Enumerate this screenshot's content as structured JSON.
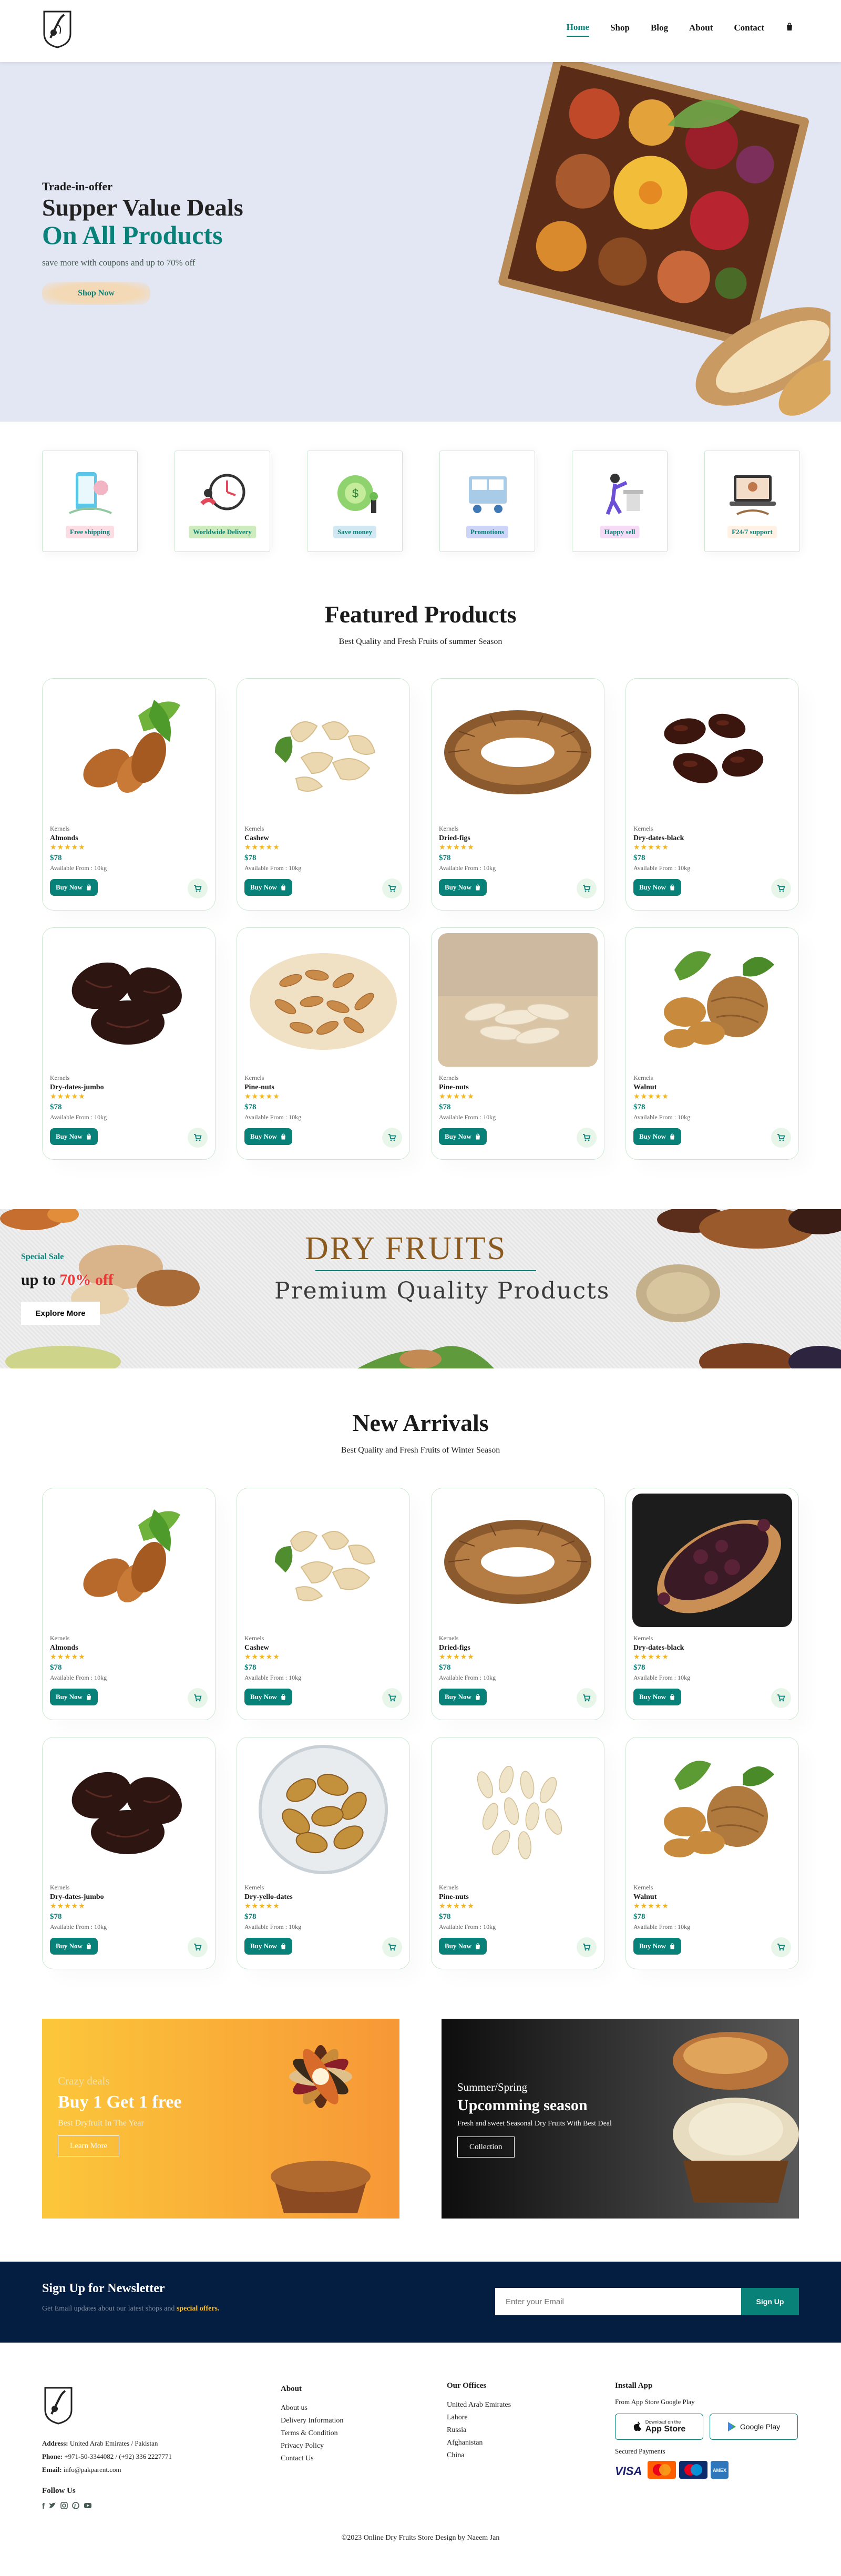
{
  "header": {
    "nav": [
      "Home",
      "Shop",
      "Blog",
      "About",
      "Contact"
    ],
    "cart_icon": "shopping-bag-icon"
  },
  "hero": {
    "subtitle": "Trade-in-offer",
    "title": "Supper Value Deals",
    "highlight": "On All Products",
    "text": "save more with coupons and up to 70% off",
    "button": "Shop Now"
  },
  "features": [
    {
      "label": "Free shipping",
      "color": "#fddde4"
    },
    {
      "label": "Worldwide Delivery",
      "color": "#cdebbc"
    },
    {
      "label": "Save money",
      "color": "#d1e8f2"
    },
    {
      "label": "Promotions",
      "color": "#cdd4f8"
    },
    {
      "label": "Happy sell",
      "color": "#f6dbf6"
    },
    {
      "label": "F24/7 support",
      "color": "#fff2e5"
    }
  ],
  "featured": {
    "title": "Featured Products",
    "subtitle": "Best Quality and Fresh Fruits of summer Season",
    "products": [
      {
        "brand": "Kernels",
        "name": "Almonds",
        "rating": "★★★★★",
        "price": "$78",
        "avail": "Available From : 10kg",
        "buy": "Buy Now"
      },
      {
        "brand": "Kernels",
        "name": "Cashew",
        "rating": "★★★★★",
        "price": "$78",
        "avail": "Available From : 10kg",
        "buy": "Buy Now"
      },
      {
        "brand": "Kernels",
        "name": "Dried-figs",
        "rating": "★★★★★",
        "price": "$78",
        "avail": "Available From : 10kg",
        "buy": "Buy Now"
      },
      {
        "brand": "Kernels",
        "name": "Dry-dates-black",
        "rating": "★★★★★",
        "price": "$78",
        "avail": "Available From : 10kg",
        "buy": "Buy Now"
      },
      {
        "brand": "Kernels",
        "name": "Dry-dates-jumbo",
        "rating": "★★★★★",
        "price": "$78",
        "avail": "Available From : 10kg",
        "buy": "Buy Now"
      },
      {
        "brand": "Kernels",
        "name": "Pine-nuts",
        "rating": "★★★★★",
        "price": "$78",
        "avail": "Available From : 10kg",
        "buy": "Buy Now"
      },
      {
        "brand": "Kernels",
        "name": "Pine-nuts",
        "rating": "★★★★★",
        "price": "$78",
        "avail": "Available From : 10kg",
        "buy": "Buy Now"
      },
      {
        "brand": "Kernels",
        "name": "Walnut",
        "rating": "★★★★★",
        "price": "$78",
        "avail": "Available From : 10kg",
        "buy": "Buy Now"
      }
    ]
  },
  "banner": {
    "special": "Special Sale",
    "upto": "up to ",
    "percent": "70% off",
    "button": "Explore More",
    "headline": "DRY FRUITS",
    "tagline": "Premium Quality Products"
  },
  "arrivals": {
    "title": "New Arrivals",
    "subtitle": "Best Quality and Fresh Fruits of Winter Season",
    "products": [
      {
        "brand": "Kernels",
        "name": "Almonds",
        "rating": "★★★★★",
        "price": "$78",
        "avail": "Available From : 10kg",
        "buy": "Buy Now"
      },
      {
        "brand": "Kernels",
        "name": "Cashew",
        "rating": "★★★★★",
        "price": "$78",
        "avail": "Available From : 10kg",
        "buy": "Buy Now"
      },
      {
        "brand": "Kernels",
        "name": "Dried-figs",
        "rating": "★★★★★",
        "price": "$78",
        "avail": "Available From : 10kg",
        "buy": "Buy Now"
      },
      {
        "brand": "Kernels",
        "name": "Dry-dates-black",
        "rating": "★★★★★",
        "price": "$78",
        "avail": "Available From : 10kg",
        "buy": "Buy Now"
      },
      {
        "brand": "Kernels",
        "name": "Dry-dates-jumbo",
        "rating": "★★★★★",
        "price": "$78",
        "avail": "Available From : 10kg",
        "buy": "Buy Now"
      },
      {
        "brand": "Kernels",
        "name": "Dry-yello-dates",
        "rating": "★★★★★",
        "price": "$78",
        "avail": "Available From : 10kg",
        "buy": "Buy Now"
      },
      {
        "brand": "Kernels",
        "name": "Pine-nuts",
        "rating": "★★★★★",
        "price": "$78",
        "avail": "Available From : 10kg",
        "buy": "Buy Now"
      },
      {
        "brand": "Kernels",
        "name": "Walnut",
        "rating": "★★★★★",
        "price": "$78",
        "avail": "Available From : 10kg",
        "buy": "Buy Now"
      }
    ]
  },
  "promo1": {
    "h4": "Crazy deals",
    "h2": "Buy 1 Get 1 free",
    "p": "Best Dryfruit In The Year",
    "button": "Learn More"
  },
  "promo2": {
    "h4": "Summer/Spring",
    "h2": "Upcomming season",
    "p": "Fresh and sweet Seasonal Dry Fruits With Best Deal",
    "button": "Collection"
  },
  "newsletter": {
    "title": "Sign Up for Newsletter",
    "text": "Get Email updates about our latest shops and ",
    "highlight": "special offers.",
    "placeholder": "Enter your Email",
    "button": "Sign Up"
  },
  "footer": {
    "address_label": "Address:",
    "address": "United Arab Emirates / Pakistan",
    "phone_label": "Phone:",
    "phone": "+971-50-3344082 / (+92) 336 2227771",
    "email_label": "Email:",
    "email": "info@pakparent.com",
    "follow": "Follow Us",
    "about_title": "About",
    "about_links": [
      "About us",
      "Delivery Information",
      "Terms & Condition",
      "Privacy Policy",
      "Contact Us"
    ],
    "offices_title": "Our Offices",
    "offices": [
      "United Arab Emirates",
      "Lahore",
      "Russia",
      "Afghanistan",
      "China"
    ],
    "install_title": "Install App",
    "install_sub": "From App Store Google Play",
    "appstore_small": "Download on the",
    "appstore": "App Store",
    "googleplay": "Google Play",
    "payment_title": "Secured Payments",
    "payments": [
      "VISA",
      "MC",
      "MC",
      "AMEX"
    ],
    "copyright": "©2023 Online Dry Fruits Store Design by Naeem Jan"
  }
}
